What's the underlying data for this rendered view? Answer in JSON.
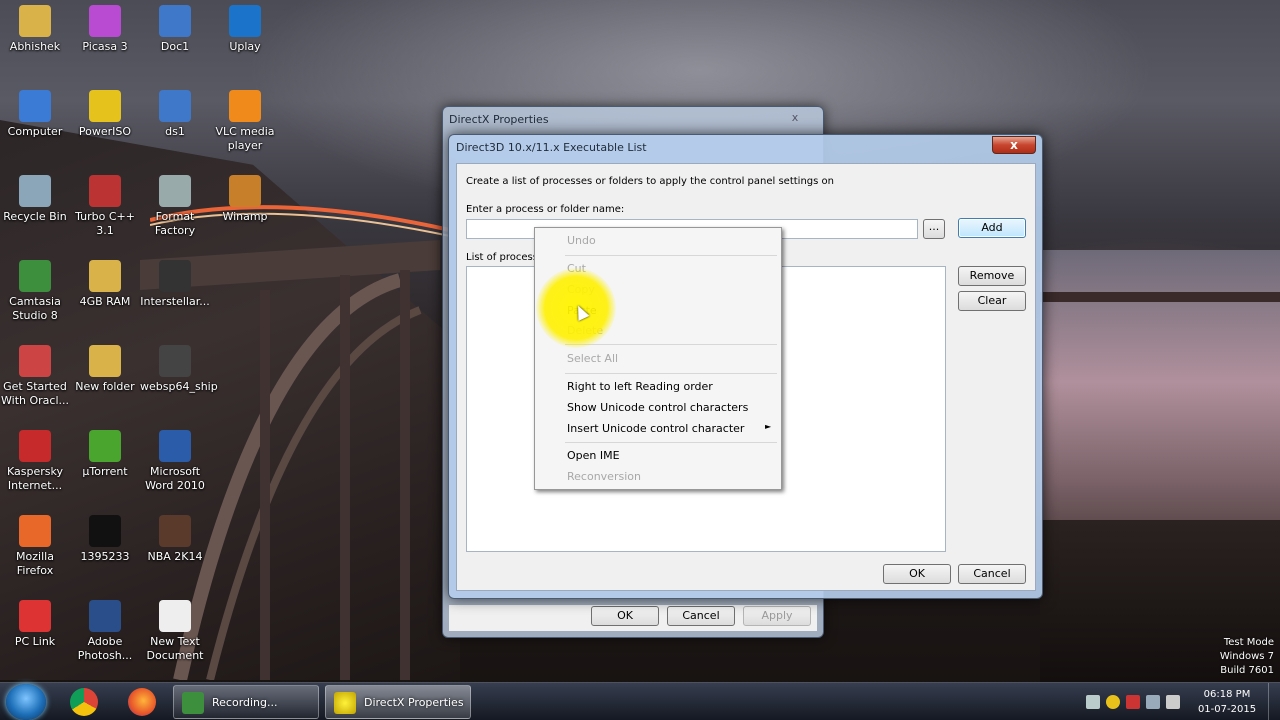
{
  "desktop": {
    "icons": [
      {
        "label": "Abhishek",
        "icon": "folder-icon",
        "color": "#d9b34a"
      },
      {
        "label": "Picasa 3",
        "icon": "picasa-icon",
        "color": "#b84bd1"
      },
      {
        "label": "Doc1",
        "icon": "document-icon",
        "color": "#3f78c9"
      },
      {
        "label": "Uplay",
        "icon": "uplay-icon",
        "color": "#1b74c9"
      },
      {
        "label": "Computer",
        "icon": "computer-icon",
        "color": "#3b7bd6"
      },
      {
        "label": "PowerISO",
        "icon": "poweriso-icon",
        "color": "#e6c21d"
      },
      {
        "label": "ds1",
        "icon": "document-icon",
        "color": "#3f78c9"
      },
      {
        "label": "VLC media player",
        "icon": "vlc-icon",
        "color": "#f08a1a"
      },
      {
        "label": "Recycle Bin",
        "icon": "recycle-bin-icon",
        "color": "#8aa6b8"
      },
      {
        "label": "Turbo C++ 3.1",
        "icon": "turbo-c-icon",
        "color": "#b33"
      },
      {
        "label": "Format Factory",
        "icon": "format-factory-icon",
        "color": "#9aa"
      },
      {
        "label": "Winamp",
        "icon": "winamp-icon",
        "color": "#c87f2a"
      },
      {
        "label": "Camtasia Studio 8",
        "icon": "camtasia-icon",
        "color": "#3d8f3d"
      },
      {
        "label": "4GB RAM",
        "icon": "folder-icon",
        "color": "#d9b34a"
      },
      {
        "label": "Interstellar...",
        "icon": "video-icon",
        "color": "#333"
      },
      {
        "label": "Get Started With Oracl...",
        "icon": "oracle-icon",
        "color": "#c44"
      },
      {
        "label": "New folder",
        "icon": "folder-icon",
        "color": "#d9b34a"
      },
      {
        "label": "websp64_ship",
        "icon": "app-icon",
        "color": "#444"
      },
      {
        "label": "Kaspersky Internet...",
        "icon": "kaspersky-icon",
        "color": "#c62a2a"
      },
      {
        "label": "µTorrent",
        "icon": "utorrent-icon",
        "color": "#4aa52e"
      },
      {
        "label": "Microsoft Word 2010",
        "icon": "word-icon",
        "color": "#2a5caa"
      },
      {
        "label": "Mozilla Firefox",
        "icon": "firefox-icon",
        "color": "#e8682a"
      },
      {
        "label": "1395233",
        "icon": "image-icon",
        "color": "#111"
      },
      {
        "label": "NBA 2K14",
        "icon": "nba-icon",
        "color": "#5a3a2a"
      },
      {
        "label": "PC Link",
        "icon": "pc-link-icon",
        "color": "#d33"
      },
      {
        "label": "Adobe Photosh...",
        "icon": "photoshop-icon",
        "color": "#2a4e8a"
      },
      {
        "label": "New Text Document",
        "icon": "text-document-icon",
        "color": "#eee"
      }
    ]
  },
  "dx_properties": {
    "title": "DirectX Properties",
    "close": "x",
    "ok": "OK",
    "cancel": "Cancel",
    "apply": "Apply"
  },
  "exe_list": {
    "title": "Direct3D 10.x/11.x Executable List",
    "close": "x",
    "description": "Create a list of processes or folders to apply the control panel settings on",
    "input_label": "Enter a process or folder name:",
    "input_value": "",
    "browse": "...",
    "add": "Add",
    "list_label": "List of processe",
    "remove": "Remove",
    "clear": "Clear",
    "ok": "OK",
    "cancel": "Cancel"
  },
  "context_menu": {
    "undo": "Undo",
    "cut": "Cut",
    "copy": "Copy",
    "paste": "Paste",
    "delete": "Delete",
    "select_all": "Select All",
    "rtl": "Right to left Reading order",
    "show_unicode": "Show Unicode control characters",
    "insert_unicode": "Insert Unicode control character",
    "submenu_arrow": "►",
    "open_ime": "Open IME",
    "reconversion": "Reconversion"
  },
  "taskbar": {
    "tasks": [
      {
        "label": "Recording...",
        "icon": "camtasia-recorder-icon"
      },
      {
        "label": "DirectX Properties",
        "icon": "directx-icon"
      }
    ],
    "clock_time": "06:18 PM",
    "clock_date": "01-07-2015"
  },
  "watermark": {
    "line1": "Test Mode",
    "line2": "Windows 7",
    "line3": "Build 7601"
  }
}
